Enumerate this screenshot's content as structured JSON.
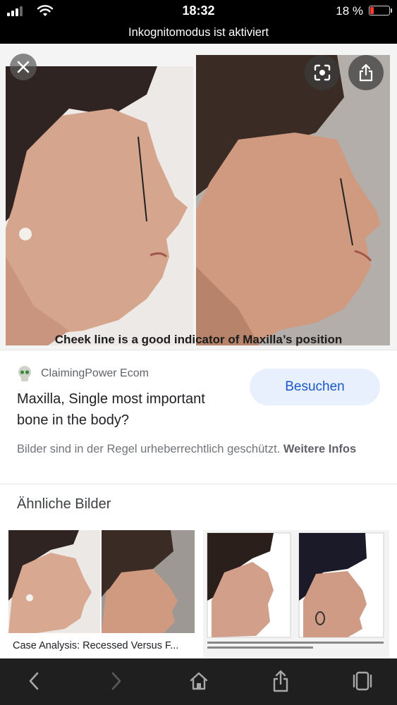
{
  "status_bar": {
    "time": "18:32",
    "battery_percent": "18 %",
    "battery_color": "#ff3b30"
  },
  "incognito_banner": "Inkognitomodus ist aktiviert",
  "image_viewer": {
    "caption": "Cheek line is a good indicator of Maxilla’s position",
    "close_icon": "close-icon",
    "lens_icon": "lens-icon",
    "share_icon": "share-icon"
  },
  "result": {
    "source_name": "ClaimingPower Ecom",
    "favicon": "skull-icon",
    "visit_label": "Besuchen",
    "title": "Maxilla, Single most important bone in the body?",
    "copyright_text": "Bilder sind in der Regel urheberrechtlich geschützt.",
    "more_info_label": "Weitere Infos"
  },
  "similar": {
    "heading": "Ähnliche Bilder",
    "items": [
      {
        "label": "Case Analysis: Recessed Versus F..."
      },
      {
        "label": ""
      }
    ]
  },
  "toolbar": {
    "back_icon": "chevron-left-icon",
    "forward_icon": "chevron-right-icon",
    "home_icon": "home-icon",
    "share_icon": "share-icon",
    "tabs_icon": "tabs-icon"
  },
  "colors": {
    "accent": "#1a57c9",
    "visit_bg": "#e8f0fe",
    "toolbar_bg": "#1f1f1f"
  }
}
